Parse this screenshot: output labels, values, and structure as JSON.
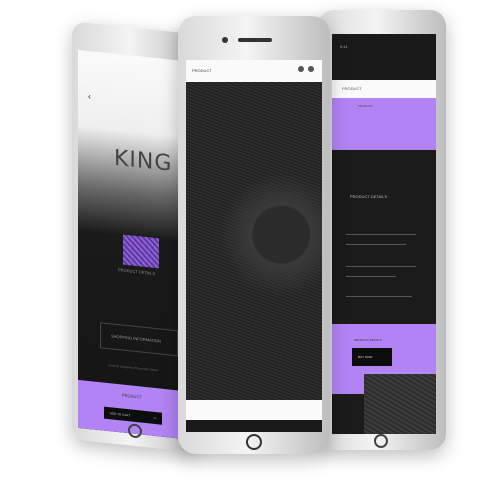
{
  "left_phone": {
    "back_glyph": "‹",
    "brand": "KING",
    "thumb_caption": "PRODUCT DETAILS",
    "box_label": "SHOPPING INFORMATION",
    "footnote": "continue shopping with product detail",
    "purple_caption": "PRODUCT",
    "button_label": "ADD TO CART",
    "button_arrow": "→"
  },
  "center_phone": {
    "header_title": "PRODUCT",
    "colors": {
      "screen": "#1a1a1a",
      "header": "#fafafa"
    }
  },
  "right_phone": {
    "status": "9:41",
    "white_bar_label": "PRODUCT",
    "purple_caption": "PRODUCT",
    "mid_title": "PRODUCT DETAILS",
    "purple2_caption": "PRODUCT DETAILS",
    "button_label": "BUY NOW"
  },
  "colors": {
    "accent": "#b183f5",
    "dark": "#111111"
  }
}
